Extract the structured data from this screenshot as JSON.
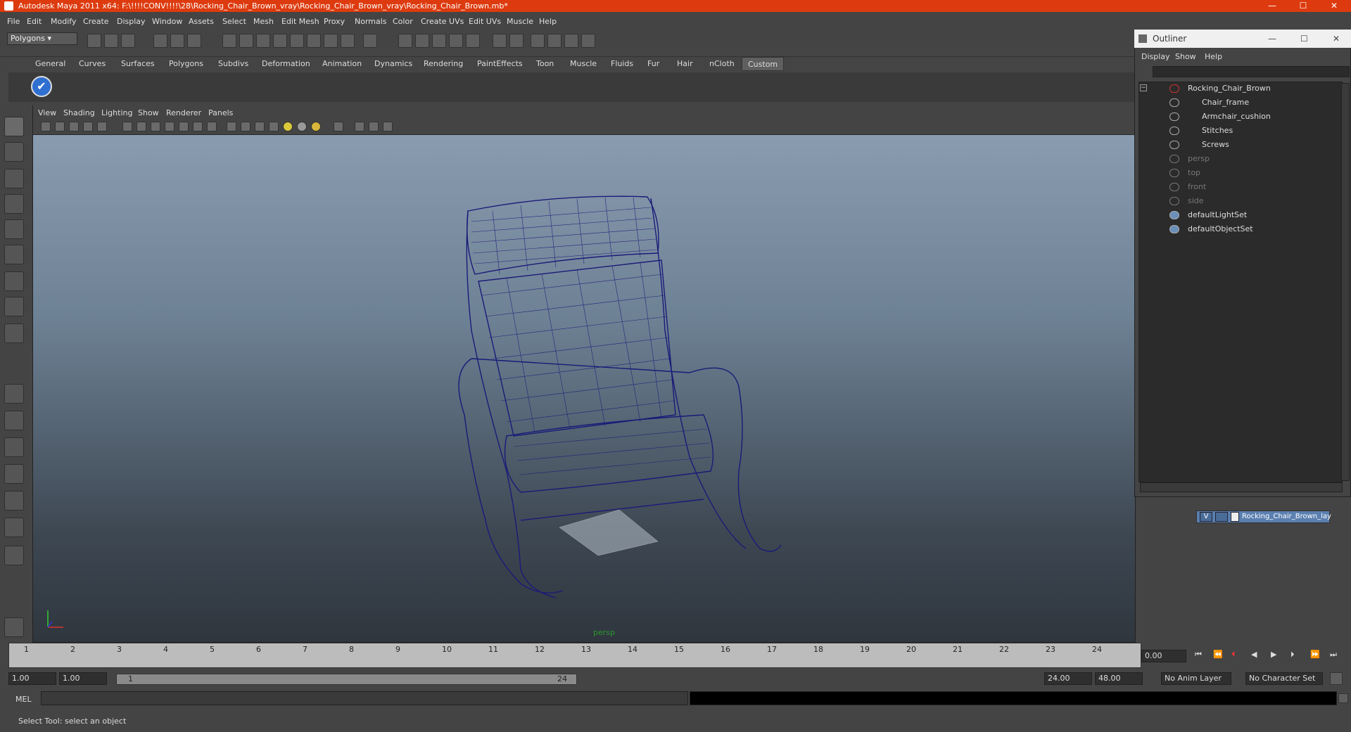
{
  "window": {
    "title": "Autodesk Maya 2011 x64: F:\\!!!!CONV!!!!\\28\\Rocking_Chair_Brown_vray\\Rocking_Chair_Brown_vray\\Rocking_Chair_Brown.mb*"
  },
  "menu": [
    "File",
    "Edit",
    "Modify",
    "Create",
    "Display",
    "Window",
    "Assets",
    "Select",
    "Mesh",
    "Edit Mesh",
    "Proxy",
    "Normals",
    "Color",
    "Create UVs",
    "Edit UVs",
    "Muscle",
    "Help"
  ],
  "status_line": {
    "mode": "Polygons"
  },
  "shelf_tabs": [
    "General",
    "Curves",
    "Surfaces",
    "Polygons",
    "Subdivs",
    "Deformation",
    "Animation",
    "Dynamics",
    "Rendering",
    "PaintEffects",
    "Toon",
    "Muscle",
    "Fluids",
    "Fur",
    "Hair",
    "nCloth",
    "Custom"
  ],
  "active_shelf_tab": "Custom",
  "viewport": {
    "menu": [
      "View",
      "Shading",
      "Lighting",
      "Show",
      "Renderer",
      "Panels"
    ],
    "camera": "persp",
    "wire_color": "#1a1a78"
  },
  "outliner": {
    "title": "Outliner",
    "menu": [
      "Display",
      "Show",
      "Help"
    ],
    "items": [
      {
        "label": "Rocking_Chair_Brown",
        "dim": false
      },
      {
        "label": "Chair_frame",
        "dim": false
      },
      {
        "label": "Armchair_cushion",
        "dim": false
      },
      {
        "label": "Stitches",
        "dim": false
      },
      {
        "label": "Screws",
        "dim": false
      },
      {
        "label": "persp",
        "dim": true
      },
      {
        "label": "top",
        "dim": true
      },
      {
        "label": "front",
        "dim": true
      },
      {
        "label": "side",
        "dim": true
      },
      {
        "label": "defaultLightSet",
        "dim": false
      },
      {
        "label": "defaultObjectSet",
        "dim": false
      }
    ]
  },
  "layers": {
    "row_visible": "V",
    "row_label": "Rocking_Chair_Brown_lay"
  },
  "timeline": {
    "ticks": [
      "1",
      "2",
      "3",
      "4",
      "5",
      "6",
      "7",
      "8",
      "9",
      "10",
      "11",
      "12",
      "13",
      "14",
      "15",
      "16",
      "17",
      "18",
      "19",
      "20",
      "21",
      "22",
      "23",
      "24"
    ],
    "current_time": "0.00"
  },
  "range": {
    "start": "1.00",
    "playback_start": "1.00",
    "slider_start": "1",
    "slider_end": "24",
    "playback_end": "24.00",
    "end": "48.00",
    "anim_layer": "No Anim Layer",
    "character_set": "No Character Set"
  },
  "command_line": {
    "label": "MEL"
  },
  "help_line": "Select Tool: select an object"
}
